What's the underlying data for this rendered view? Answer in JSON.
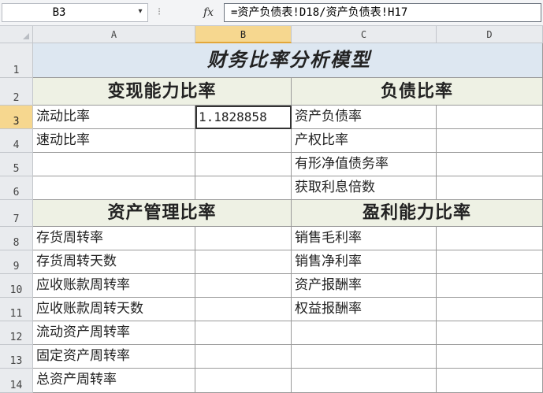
{
  "formula_bar": {
    "name_box": "B3",
    "name_arrow": "▾",
    "fx": "fx",
    "formula": "=资产负债表!D18/资产负债表!H17"
  },
  "columns": [
    "A",
    "B",
    "C",
    "D"
  ],
  "rows": [
    "1",
    "2",
    "3",
    "4",
    "5",
    "6",
    "7",
    "8",
    "9",
    "10",
    "11",
    "12",
    "13",
    "14"
  ],
  "sheet": {
    "title": "财务比率分析模型",
    "sections": {
      "liquidity": "变现能力比率",
      "debt": "负债比率",
      "asset_mgmt": "资产管理比率",
      "profit": "盈利能力比率"
    },
    "a_labels": {
      "r3": "流动比率",
      "r4": "速动比率",
      "r8": "存货周转率",
      "r9": "存货周转天数",
      "r10": "应收账款周转率",
      "r11": "应收账款周转天数",
      "r12": "流动资产周转率",
      "r13": "固定资产周转率",
      "r14": "总资产周转率"
    },
    "c_labels": {
      "r3": "资产负债率",
      "r4": "产权比率",
      "r5": "有形净值债务率",
      "r6": "获取利息倍数",
      "r8": "销售毛利率",
      "r9": "销售净利率",
      "r10": "资产报酬率",
      "r11": "权益报酬率"
    },
    "b3_value": "1.1828858"
  },
  "colors": {
    "title_bg": "#dde7f1",
    "section_bg": "#eef1e4",
    "selected_header": "#f6d78f"
  }
}
